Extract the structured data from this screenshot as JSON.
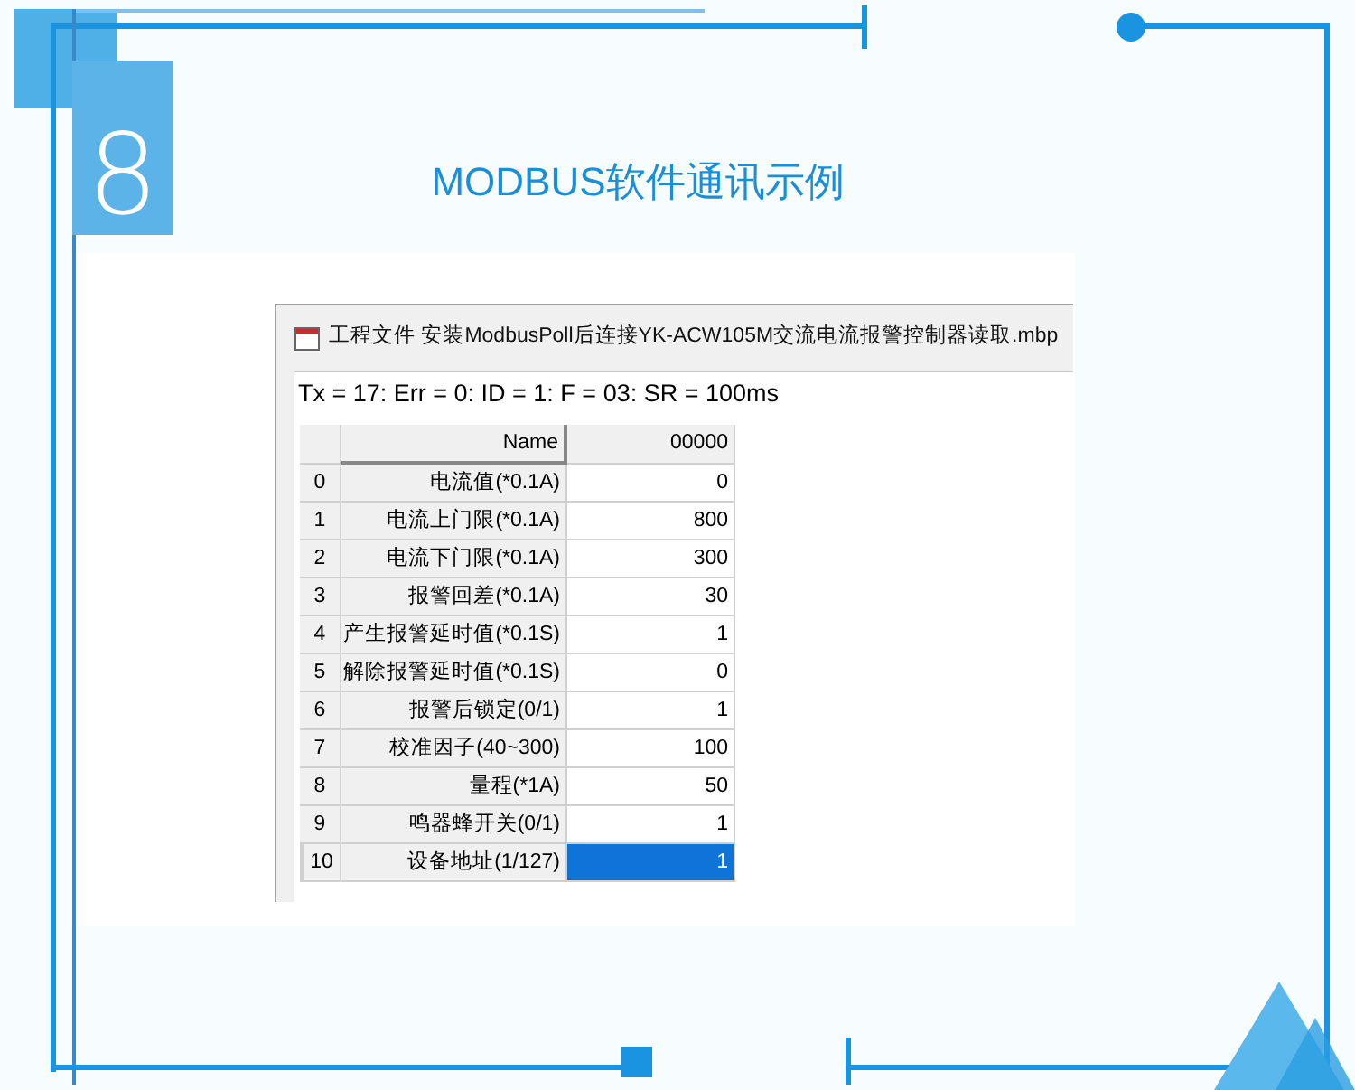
{
  "page": {
    "number": "8",
    "title": "MODBUS软件通讯示例"
  },
  "window": {
    "title": "工程文件 安装ModbusPoll后连接YK-ACW105M交流电流报警控制器读取.mbp",
    "status": "Tx = 17: Err = 0: ID = 1: F = 03: SR = 100ms"
  },
  "table": {
    "columns": [
      "Name",
      "00000"
    ],
    "rows": [
      {
        "index": "0",
        "name": "电流值(*0.1A)",
        "value": "0",
        "selected": false
      },
      {
        "index": "1",
        "name": "电流上门限(*0.1A)",
        "value": "800",
        "selected": false
      },
      {
        "index": "2",
        "name": "电流下门限(*0.1A)",
        "value": "300",
        "selected": false
      },
      {
        "index": "3",
        "name": "报警回差(*0.1A)",
        "value": "30",
        "selected": false
      },
      {
        "index": "4",
        "name": "产生报警延时值(*0.1S)",
        "value": "1",
        "selected": false
      },
      {
        "index": "5",
        "name": "解除报警延时值(*0.1S)",
        "value": "0",
        "selected": false
      },
      {
        "index": "6",
        "name": "报警后锁定(0/1)",
        "value": "1",
        "selected": false
      },
      {
        "index": "7",
        "name": "校准因子(40~300)",
        "value": "100",
        "selected": false
      },
      {
        "index": "8",
        "name": "量程(*1A)",
        "value": "50",
        "selected": false
      },
      {
        "index": "9",
        "name": "鸣器蜂开关(0/1)",
        "value": "1",
        "selected": false
      },
      {
        "index": "10",
        "name": "设备地址(1/127)",
        "value": "1",
        "selected": true
      }
    ]
  }
}
